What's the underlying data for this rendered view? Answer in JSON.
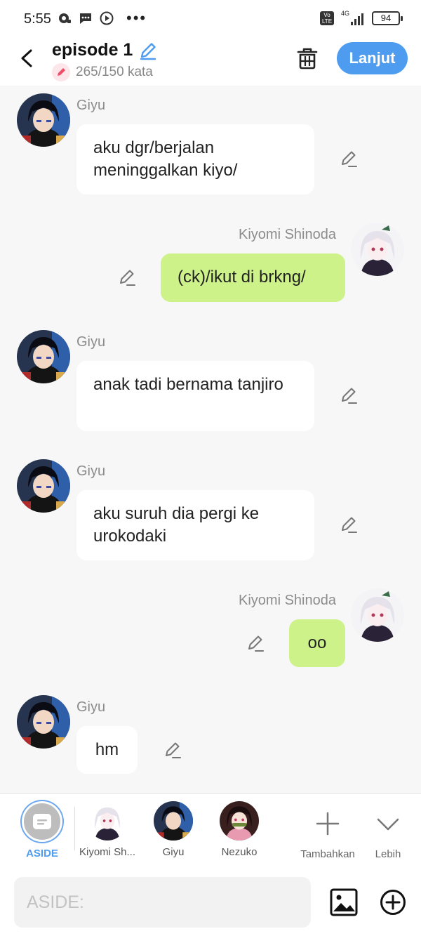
{
  "status_bar": {
    "time": "5:55",
    "network": "4G",
    "volte": "Vo LTE",
    "battery": "94"
  },
  "header": {
    "title": "episode 1",
    "word_count": "265/150 kata",
    "next_label": "Lanjut"
  },
  "messages": [
    {
      "speaker": "Giyu",
      "side": "left",
      "text": "aku dgr/berjalan meninggalkan kiyo/"
    },
    {
      "speaker": "Kiyomi Shinoda",
      "side": "right",
      "text": "(ck)/ikut di brkng/"
    },
    {
      "speaker": "Giyu",
      "side": "left",
      "text": "anak tadi bernama tanjiro"
    },
    {
      "speaker": "Giyu",
      "side": "left",
      "text": "aku suruh dia pergi ke urokodaki"
    },
    {
      "speaker": "Kiyomi Shinoda",
      "side": "right",
      "text": "oo"
    },
    {
      "speaker": "Giyu",
      "side": "left",
      "text": "hm"
    }
  ],
  "characters": [
    {
      "label": "ASIDE",
      "active": true
    },
    {
      "label": "Kiyomi Sh..."
    },
    {
      "label": "Giyu"
    },
    {
      "label": "Nezuko"
    }
  ],
  "actions": {
    "add": "Tambahkan",
    "more": "Lebih"
  },
  "input": {
    "placeholder": "ASIDE:"
  },
  "colors": {
    "accent": "#4d9cf0",
    "right_bubble": "#cdf28a",
    "left_bubble": "#ffffff",
    "background": "#f7f7f7"
  },
  "icons": [
    "back-icon",
    "edit-title-icon",
    "pencil-icon",
    "trash-icon",
    "image-icon",
    "plus-circle-icon",
    "plus-icon",
    "chevron-down-icon"
  ]
}
